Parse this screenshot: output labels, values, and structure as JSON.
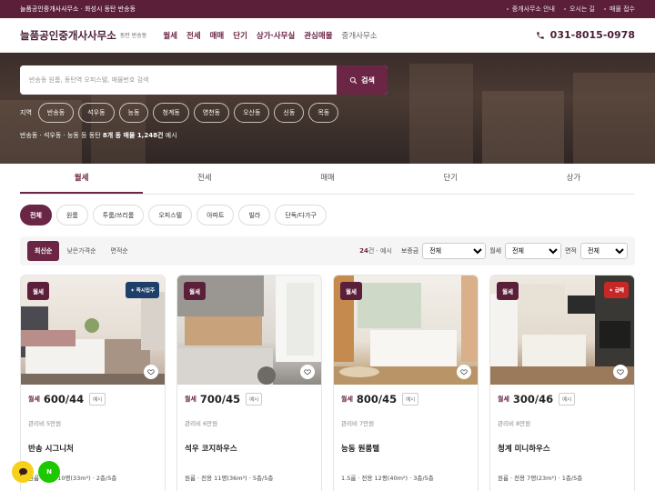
{
  "topbar": {
    "left": "늘품공인중개사사무소 · 화성시 동탄 반송동",
    "links": [
      "중개사무소 안내",
      "오시는 길",
      "매물 접수"
    ]
  },
  "header": {
    "logo": "늘품공인중개사사무소",
    "logo_sub": "동탄 반송동",
    "nav": [
      "월세",
      "전세",
      "매매",
      "단기",
      "상가·사무실",
      "관심매물",
      "중개사무소"
    ],
    "phone": "031-8015-0978",
    "phone_icon": "phone-icon"
  },
  "search": {
    "placeholder": "반송동 원룸, 동탄역 오피스텔, 매물번호 검색",
    "button": "검색",
    "search_icon": "search-icon"
  },
  "regions": {
    "label": "지역",
    "items": [
      "반송동",
      "석우동",
      "능동",
      "청계동",
      "영천동",
      "오산동",
      "신동",
      "목동"
    ]
  },
  "hero_info": {
    "prefix": "반송동 · 석우동 · 능동 등 동탄 ",
    "bold": "8개 동 매물 1,248건",
    "suffix": " 예시"
  },
  "tabs": [
    "월세",
    "전세",
    "매매",
    "단기",
    "상가"
  ],
  "subtypes": [
    "전체",
    "원룸",
    "투룸/쓰리룸",
    "오피스텔",
    "아파트",
    "빌라",
    "단독/다가구"
  ],
  "sort": {
    "options": [
      "최신순",
      "낮은가격순",
      "면적순"
    ],
    "count_num": "24",
    "count_suffix": "건 · 예시",
    "filters": [
      {
        "label": "보증금",
        "value": "전체"
      },
      {
        "label": "월세",
        "value": "전체"
      },
      {
        "label": "면적",
        "value": "전체"
      }
    ]
  },
  "listings": [
    {
      "badge": "월세",
      "tag": "✦ 즉시입주",
      "tag_color": "#1f3f6b",
      "type": "월세",
      "price": "600/44",
      "example": "예시",
      "fee": "관리비 5만원",
      "title": "반송 시그니처",
      "info": "원룸 · 전용 10평(33m²) · 2층/5층"
    },
    {
      "badge": "월세",
      "tag": "",
      "tag_color": "",
      "type": "월세",
      "price": "700/45",
      "example": "예시",
      "fee": "관리비 6만원",
      "title": "석우 코지하우스",
      "info": "원룸 · 전용 11평(36m²) · 5층/5층"
    },
    {
      "badge": "월세",
      "tag": "",
      "tag_color": "",
      "type": "월세",
      "price": "800/45",
      "example": "예시",
      "fee": "관리비 7만원",
      "title": "능동 원룸텔",
      "info": "1.5룸 · 전용 12평(40m²) · 3층/5층"
    },
    {
      "badge": "월세",
      "tag": "✦ 급매",
      "tag_color": "#c62828",
      "type": "월세",
      "price": "300/46",
      "example": "예시",
      "fee": "관리비 8만원",
      "title": "청계 미니하우스",
      "info": "원룸 · 전용 7평(23m²) · 1층/5층"
    }
  ],
  "floating": {
    "chat": "chat-icon",
    "naver": "N"
  },
  "colors": {
    "brand": "#6b2545",
    "topbar": "#5b1f3a"
  }
}
